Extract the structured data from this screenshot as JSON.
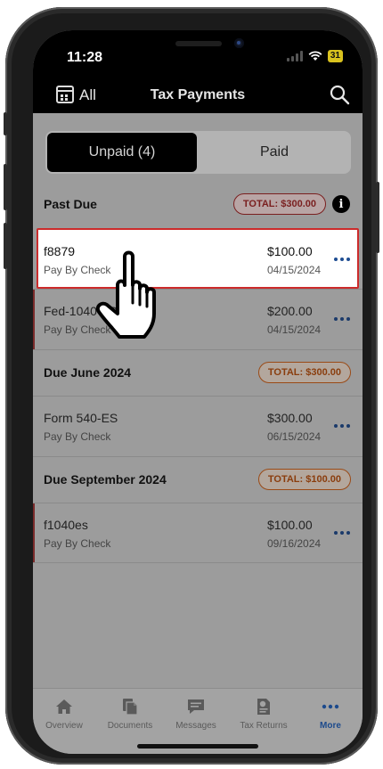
{
  "status": {
    "time": "11:28",
    "battery": "31"
  },
  "nav": {
    "left_label": "All",
    "title": "Tax Payments"
  },
  "tabs_segment": {
    "unpaid": "Unpaid (4)",
    "paid": "Paid"
  },
  "sections": [
    {
      "title": "Past Due",
      "total": "TOTAL: $300.00"
    },
    {
      "title": "Due June 2024",
      "total": "TOTAL: $300.00"
    },
    {
      "title": "Due September 2024",
      "total": "TOTAL: $100.00"
    }
  ],
  "payments": [
    {
      "name": "f8879",
      "method": "Pay By Check",
      "amount": "$100.00",
      "date": "04/15/2024"
    },
    {
      "name": "Fed-1040 ES",
      "method": "Pay By Check",
      "amount": "$200.00",
      "date": "04/15/2024"
    },
    {
      "name": "Form 540-ES",
      "method": "Pay By Check",
      "amount": "$300.00",
      "date": "06/15/2024"
    },
    {
      "name": "f1040es",
      "method": "Pay By Check",
      "amount": "$100.00",
      "date": "09/16/2024"
    }
  ],
  "tabbar": [
    {
      "label": "Overview",
      "icon": "home-icon"
    },
    {
      "label": "Documents",
      "icon": "documents-icon"
    },
    {
      "label": "Messages",
      "icon": "messages-icon"
    },
    {
      "label": "Tax Returns",
      "icon": "tax-returns-icon"
    },
    {
      "label": "More",
      "icon": "more-icon"
    }
  ],
  "colors": {
    "accent": "#1c4a8c",
    "highlight_border": "#cc2b2b",
    "past_due": "#7a1f1f",
    "upcoming": "#9a4a16"
  }
}
